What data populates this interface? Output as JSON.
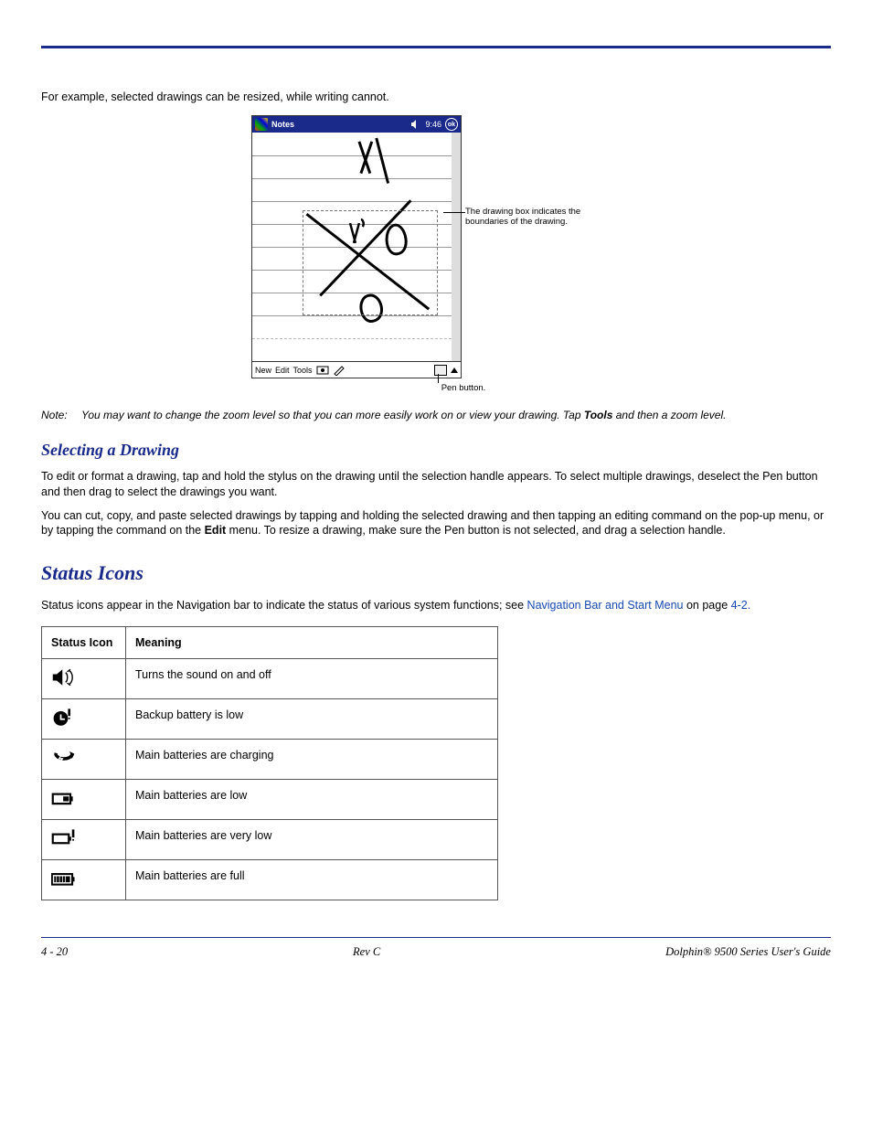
{
  "intro_text": "For example, selected drawings can be resized, while writing cannot.",
  "screenshot": {
    "title": "Notes",
    "time": "9:46",
    "ok": "ok",
    "menu_new": "New",
    "menu_edit": "Edit",
    "menu_tools": "Tools",
    "callout": "The drawing box indicates the boundaries of the drawing.",
    "pen_label": "Pen button."
  },
  "note": {
    "label": "Note:",
    "text_a": "You may want to change the zoom level so that you can more easily work on or view your drawing. Tap ",
    "tools": "Tools",
    "text_b": " and then a zoom level."
  },
  "selecting": {
    "heading": "Selecting a Drawing",
    "p1": "To edit or format a drawing, tap and hold the stylus on the drawing until the selection handle appears. To select multiple drawings, deselect the Pen button and then drag to select the drawings you want.",
    "p2_a": "You can cut, copy, and paste selected drawings by tapping and holding the selected drawing and then tapping an editing command on the pop-up menu, or by tapping the command on the ",
    "p2_edit": "Edit",
    "p2_b": " menu. To resize a drawing, make sure the Pen button is not selected, and drag a selection handle."
  },
  "status": {
    "heading": "Status Icons",
    "intro_a": "Status icons appear in the Navigation bar to indicate the status of various system functions; see ",
    "link": "Navigation Bar and Start Menu",
    "intro_b": " on page ",
    "pageref": "4-2.",
    "col_icon": "Status Icon",
    "col_meaning": "Meaning",
    "rows": [
      {
        "icon": "speaker-icon",
        "meaning": "Turns the sound on and off"
      },
      {
        "icon": "backup-low-icon",
        "meaning": "Backup battery is low"
      },
      {
        "icon": "charging-icon",
        "meaning": "Main batteries are charging"
      },
      {
        "icon": "low-icon",
        "meaning": "Main batteries are low"
      },
      {
        "icon": "very-low-icon",
        "meaning": "Main batteries are very low"
      },
      {
        "icon": "full-icon",
        "meaning": "Main batteries are full"
      }
    ]
  },
  "footer": {
    "left": "4 - 20",
    "mid": "Rev C",
    "right": "Dolphin® 9500 Series User's Guide"
  }
}
